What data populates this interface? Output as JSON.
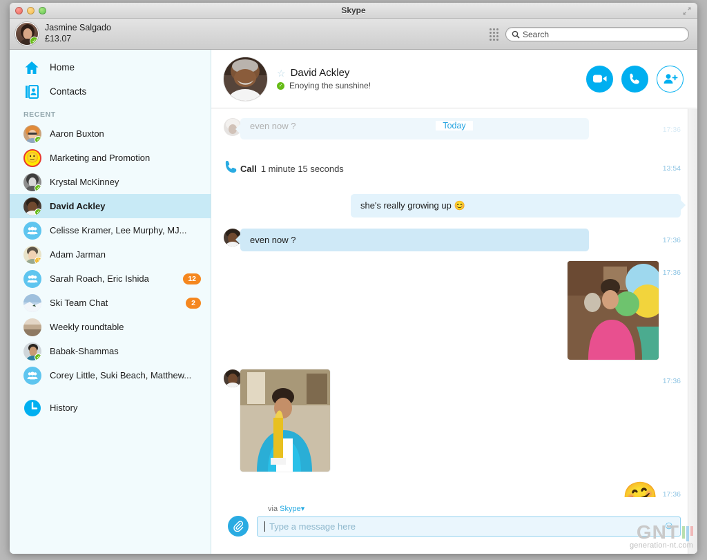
{
  "window": {
    "title": "Skype",
    "expand_icon": "fullscreen-arrows-icon",
    "traffic_lights": [
      "close",
      "minimize",
      "zoom"
    ]
  },
  "toolbar": {
    "user_name": "Jasmine Salgado",
    "balance": "£13.07",
    "user_status": "online",
    "dialpad_icon": "dialpad-icon",
    "search": {
      "placeholder": "Search",
      "value": "",
      "icon": "search-icon"
    }
  },
  "sidebar": {
    "nav": [
      {
        "label": "Home",
        "icon": "home-icon"
      },
      {
        "label": "Contacts",
        "icon": "contacts-card-icon"
      }
    ],
    "section_header": "RECENT",
    "recents": [
      {
        "name": "Aaron Buxton",
        "status": "online",
        "avatar": "photo",
        "badge": "",
        "active": false
      },
      {
        "name": "Marketing and Promotion",
        "status": "",
        "avatar": "smiley",
        "badge": "",
        "active": false
      },
      {
        "name": "Krystal McKinney",
        "status": "online",
        "avatar": "photo",
        "badge": "",
        "active": false
      },
      {
        "name": "David Ackley",
        "status": "online",
        "avatar": "photo",
        "badge": "",
        "active": true
      },
      {
        "name": "Celisse Kramer, Lee Murphy, MJ...",
        "status": "",
        "avatar": "group",
        "badge": "",
        "active": false
      },
      {
        "name": "Adam Jarman",
        "status": "away",
        "avatar": "photo",
        "badge": "",
        "active": false
      },
      {
        "name": "Sarah Roach, Eric Ishida",
        "status": "",
        "avatar": "group",
        "badge": "12",
        "active": false
      },
      {
        "name": "Ski Team Chat",
        "status": "",
        "avatar": "photo",
        "badge": "2",
        "active": false
      },
      {
        "name": "Weekly roundtable",
        "status": "",
        "avatar": "photo",
        "badge": "",
        "active": false
      },
      {
        "name": "Babak-Shammas",
        "status": "online",
        "avatar": "photo",
        "badge": "",
        "active": false
      },
      {
        "name": "Corey Little, Suki Beach, Matthew...",
        "status": "",
        "avatar": "group",
        "badge": "",
        "active": false
      }
    ],
    "history": {
      "label": "History",
      "icon": "clock-icon"
    }
  },
  "chat_header": {
    "contact_name": "David Ackley",
    "mood_message": "Enoying the sunshine!",
    "favorite_icon": "star-icon",
    "status": "online",
    "actions": [
      {
        "name": "video-call-button",
        "icon": "video-camera-icon"
      },
      {
        "name": "voice-call-button",
        "icon": "phone-icon"
      },
      {
        "name": "add-people-button",
        "icon": "add-person-icon"
      }
    ]
  },
  "conversation": {
    "day_divider": "Today",
    "scrolled_message": {
      "text": "even now ?",
      "time": "17:36"
    },
    "messages": [
      {
        "type": "call",
        "icon": "phone-icon",
        "label": "Call",
        "duration": "1 minute 15 seconds",
        "time": "13:54"
      },
      {
        "type": "text",
        "direction": "out",
        "text": "she's really growing up 😊",
        "time": ""
      },
      {
        "type": "text",
        "direction": "in",
        "text": "even now ?",
        "time": "17:36"
      },
      {
        "type": "photo",
        "direction": "out",
        "caption": "girl-with-balloons-photo",
        "time": "17:36"
      },
      {
        "type": "photo",
        "direction": "in",
        "caption": "boy-with-trophy-photo",
        "time": "17:36"
      },
      {
        "type": "emoji",
        "direction": "out",
        "glyph": "🤗",
        "time": "17:36"
      }
    ]
  },
  "composer": {
    "via_prefix": "via",
    "via_service": "Skype",
    "via_caret": "▾",
    "attach_icon": "paperclip-icon",
    "input_placeholder": "Type a message here",
    "input_value": "",
    "emoji_icon": "smiley-icon"
  },
  "watermark": {
    "brand": "GNT",
    "site": "generation-nt.com"
  },
  "colors": {
    "skype_blue": "#00aff0",
    "badge_orange": "#f5871f",
    "online_green": "#66bb16",
    "away_yellow": "#f1b31c",
    "bubble_in": "#cfe9f7",
    "bubble_out": "#e3f3fc",
    "sidebar_bg": "#f2fbfd",
    "active_row": "#c8eaf6"
  }
}
